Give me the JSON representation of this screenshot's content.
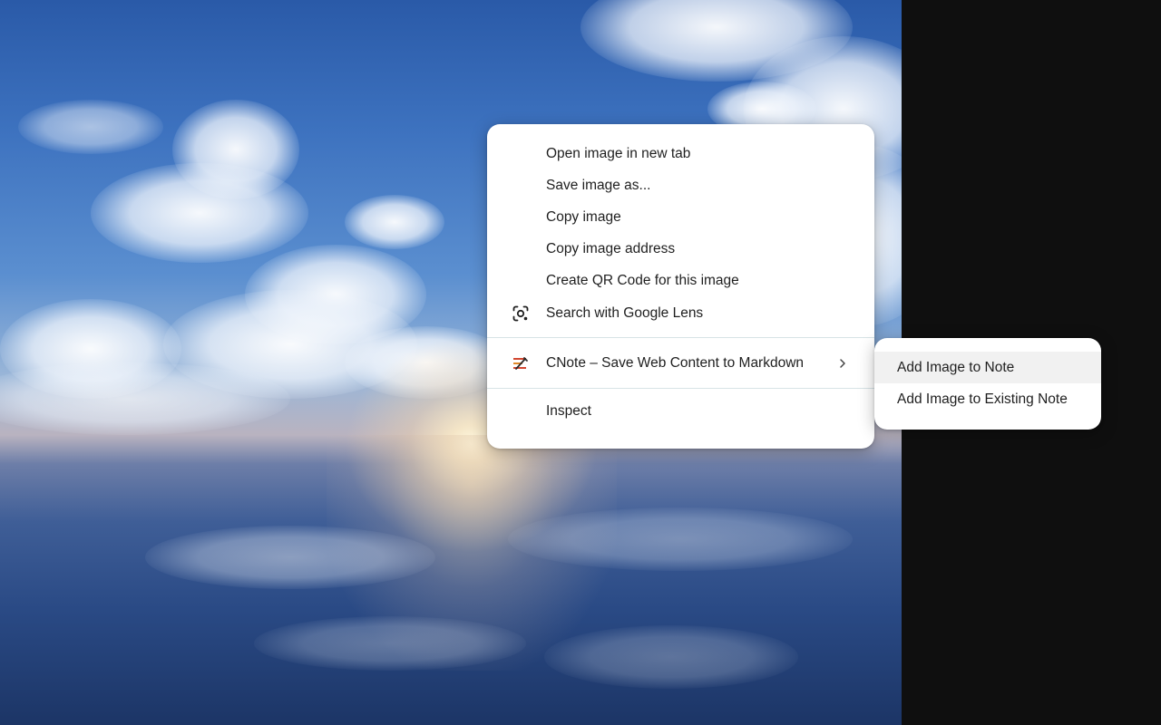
{
  "context_menu": {
    "items": [
      {
        "label": "Open image in new tab"
      },
      {
        "label": "Save image as..."
      },
      {
        "label": "Copy image"
      },
      {
        "label": "Copy image address"
      },
      {
        "label": "Create QR Code for this image"
      },
      {
        "label": "Search with Google Lens",
        "icon": "google-lens-icon"
      }
    ],
    "extension_item": {
      "label": "CNote – Save Web Content to Markdown",
      "icon": "cnote-extension-icon",
      "has_submenu": true
    },
    "inspect_label": "Inspect"
  },
  "submenu": {
    "items": [
      {
        "label": "Add Image to Note",
        "highlighted": true
      },
      {
        "label": "Add Image to Existing Note",
        "highlighted": false
      }
    ]
  },
  "colors": {
    "menu_background": "#ffffff",
    "menu_text": "#1f1f1f",
    "separator": "#d7e3e6",
    "highlight": "#f1f1f1",
    "page_background": "#0f0f0f"
  }
}
